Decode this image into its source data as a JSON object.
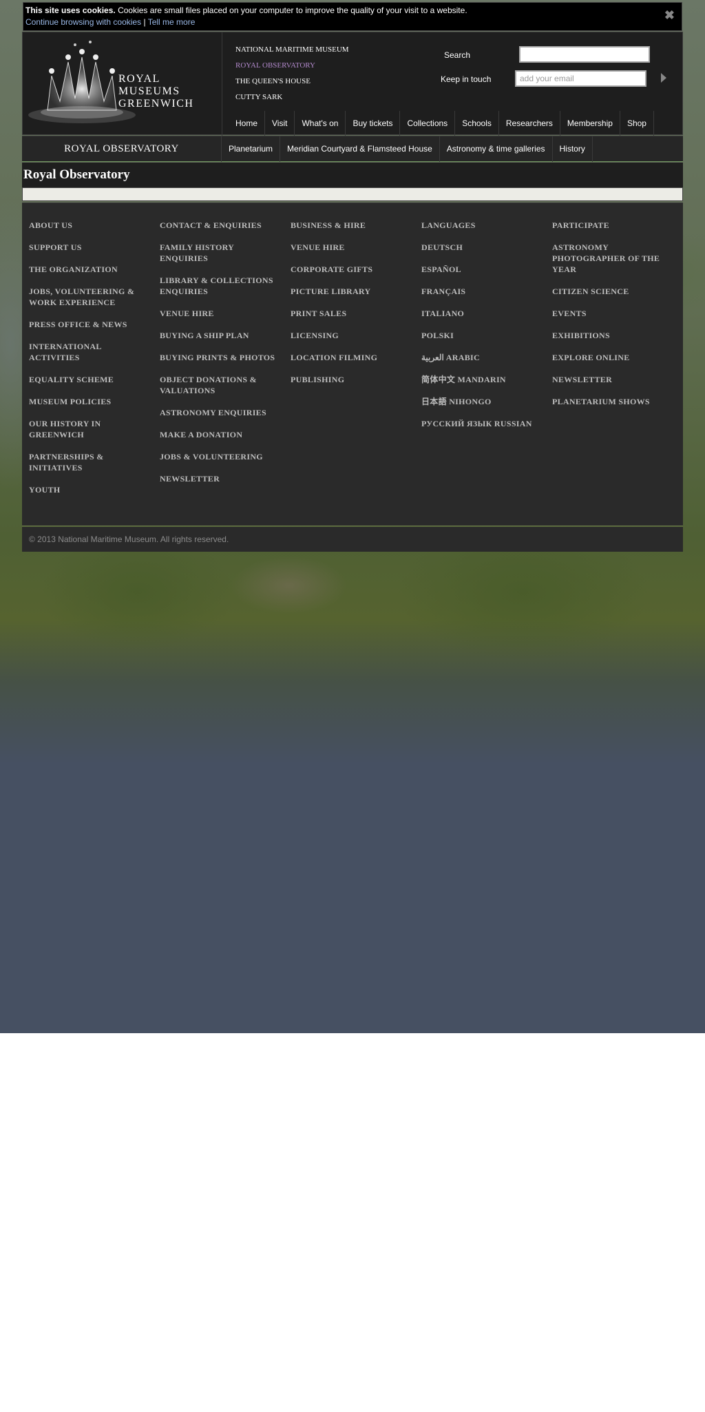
{
  "cookie": {
    "bold": "This site uses cookies.",
    "text": "Cookies are small files placed on your computer to improve the quality of your visit to a website.",
    "continue_link": "Continue browsing with cookies",
    "separator": "|",
    "tell_link": "Tell me more",
    "close_icon": "close-icon"
  },
  "logo": {
    "line1": "ROYAL",
    "line2": "MUSEUMS",
    "line3": "GREENWICH"
  },
  "sites": [
    "NATIONAL MARITIME MUSEUM",
    "ROYAL OBSERVATORY",
    "THE QUEEN'S HOUSE",
    "CUTTY SARK"
  ],
  "search": {
    "label": "Search",
    "value": ""
  },
  "newsletter": {
    "label": "Keep in touch",
    "placeholder": "add your email"
  },
  "main_nav": [
    "Home",
    "Visit",
    "What's on",
    "Buy tickets",
    "Collections",
    "Schools",
    "Researchers",
    "Membership",
    "Shop"
  ],
  "subnav": {
    "title": "ROYAL OBSERVATORY",
    "items": [
      "Planetarium",
      "Meridian Courtyard & Flamsteed House",
      "Astronomy & time galleries",
      "History"
    ]
  },
  "page": {
    "title": "Royal Observatory"
  },
  "footer": {
    "col1": [
      "ABOUT US",
      "SUPPORT US",
      "THE ORGANIZATION",
      "JOBS, VOLUNTEERING & WORK EXPERIENCE",
      "PRESS OFFICE & NEWS",
      "INTERNATIONAL ACTIVITIES",
      "EQUALITY SCHEME",
      "MUSEUM POLICIES",
      "OUR HISTORY IN GREENWICH",
      "PARTNERSHIPS & INITIATIVES",
      "YOUTH"
    ],
    "col2": [
      "CONTACT & ENQUIRIES",
      "FAMILY HISTORY ENQUIRIES",
      "LIBRARY & COLLECTIONS ENQUIRIES",
      "VENUE HIRE",
      "BUYING A SHIP PLAN",
      "BUYING PRINTS & PHOTOS",
      "OBJECT DONATIONS & VALUATIONS",
      "ASTRONOMY ENQUIRIES",
      "MAKE A DONATION",
      "JOBS & VOLUNTEERING",
      "NEWSLETTER"
    ],
    "col3": [
      "BUSINESS & HIRE",
      "VENUE HIRE",
      "CORPORATE GIFTS",
      "PICTURE LIBRARY",
      "PRINT SALES",
      "LICENSING",
      "LOCATION FILMING",
      "PUBLISHING"
    ],
    "col4": [
      "LANGUAGES",
      "DEUTSCH",
      "ESPAÑOL",
      "FRANÇAIS",
      "ITALIANO",
      "POLSKI",
      "العربية ARABIC",
      "简体中文 MANDARIN",
      "日本語 NIHONGO",
      "РУССКИЙ ЯЗЫК RUSSIAN"
    ],
    "col5": [
      "PARTICIPATE",
      "ASTRONOMY PHOTOGRAPHER OF THE YEAR",
      "CITIZEN SCIENCE",
      "EVENTS",
      "EXHIBITIONS",
      "EXPLORE ONLINE",
      "NEWSLETTER",
      "PLANETARIUM SHOWS"
    ]
  },
  "copyright": "© 2013 National Maritime Museum. All rights reserved."
}
